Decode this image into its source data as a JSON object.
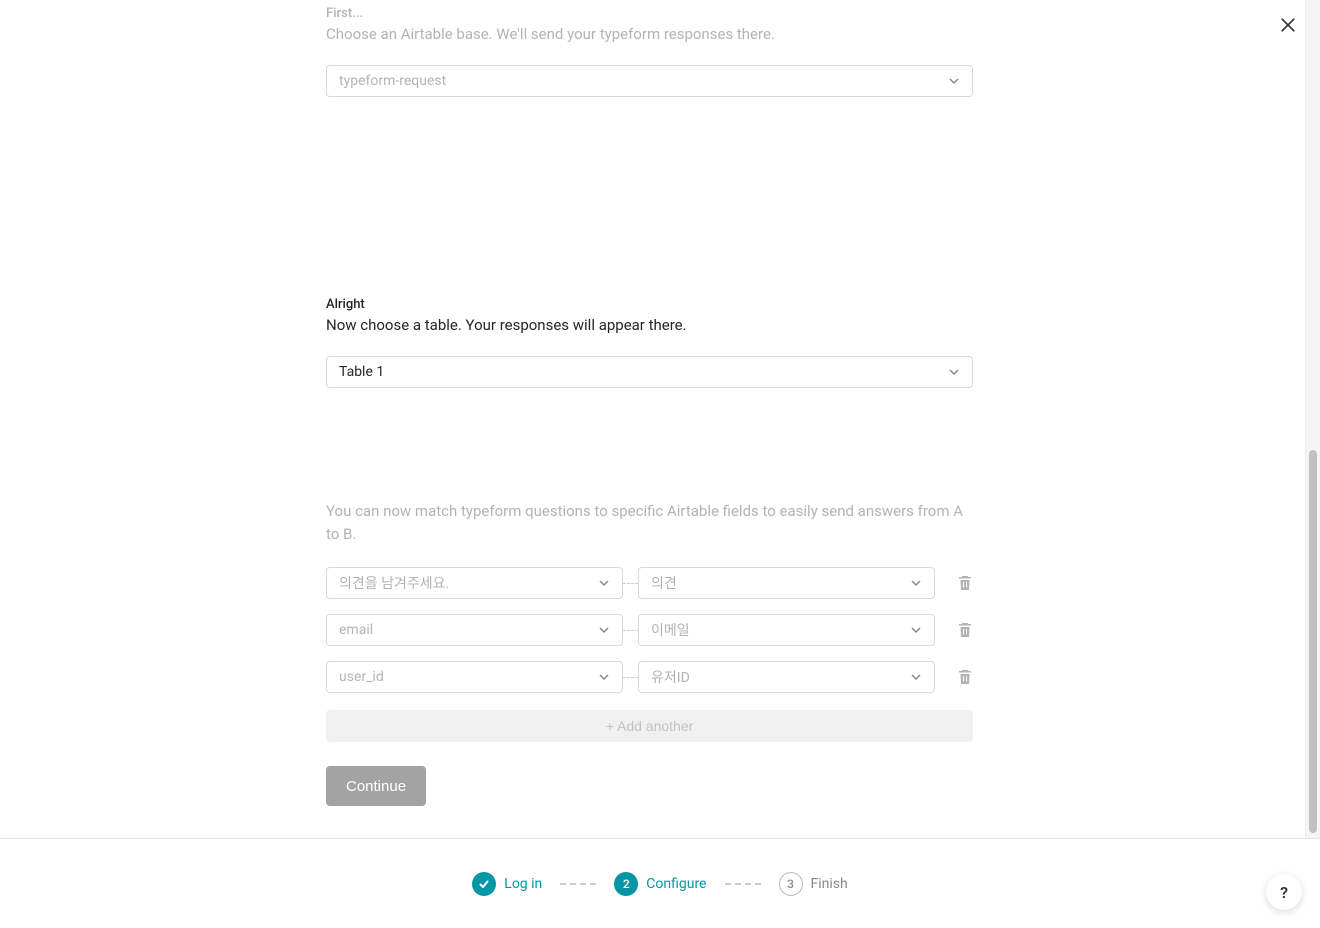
{
  "section_base": {
    "eyebrow": "First...",
    "prompt": "Choose an Airtable base. We'll send your typeform responses there.",
    "selected": "typeform-request"
  },
  "section_table": {
    "eyebrow": "Alright",
    "prompt": "Now choose a table. Your responses will appear there.",
    "selected": "Table 1"
  },
  "section_map": {
    "instruction": "You can now match typeform questions to specific Airtable fields to easily send answers from A to B.",
    "rows": [
      {
        "left": "의견을 남겨주세요.",
        "right": "의견"
      },
      {
        "left": "email",
        "right": "이메일"
      },
      {
        "left": "user_id",
        "right": "유저ID"
      }
    ],
    "add_label": "+ Add another"
  },
  "continue_label": "Continue",
  "stepper": {
    "step1": "Log in",
    "step2_num": "2",
    "step2": "Configure",
    "step3_num": "3",
    "step3": "Finish"
  },
  "help_label": "?"
}
